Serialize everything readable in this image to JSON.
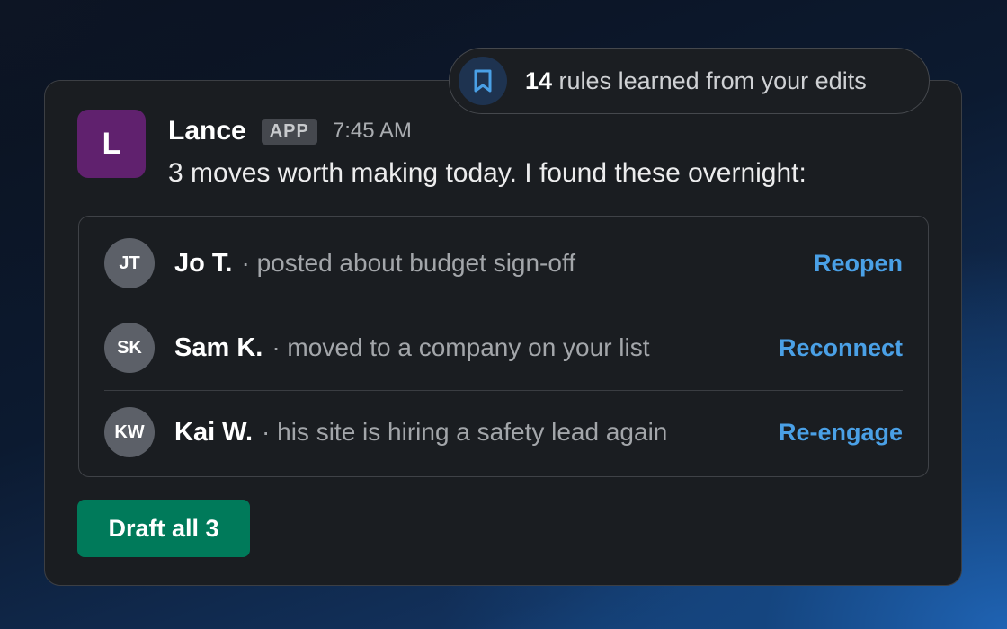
{
  "banner": {
    "icon": "bookmark-icon",
    "count": "14",
    "text": " rules learned from your edits"
  },
  "message": {
    "avatar_initial": "L",
    "sender": "Lance",
    "badge": "APP",
    "time": "7:45 AM",
    "text": "3 moves worth making today. I found these overnight:"
  },
  "items": [
    {
      "initials": "JT",
      "name": "Jo T.",
      "desc": "· posted about budget sign-off",
      "action": "Reopen"
    },
    {
      "initials": "SK",
      "name": "Sam K.",
      "desc": "· moved to a company on your list",
      "action": "Reconnect"
    },
    {
      "initials": "KW",
      "name": "Kai W.",
      "desc": "· his site is hiring a safety lead again",
      "action": "Re-engage"
    }
  ],
  "draft_button": {
    "label": "Draft all 3"
  },
  "colors": {
    "accent_link": "#4aa0e6",
    "primary_button": "#007a5a",
    "avatar_app": "#60216e"
  }
}
